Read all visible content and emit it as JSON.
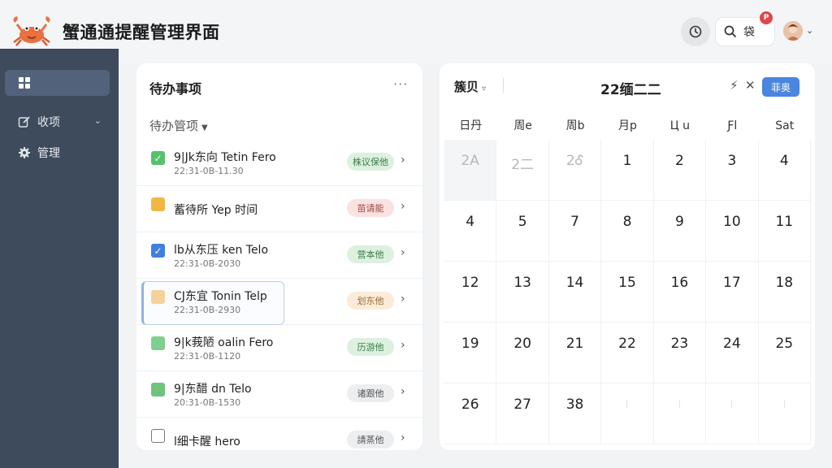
{
  "header": {
    "title": "蟹通通提醒管理界面",
    "search_label": "袋",
    "notif_badge": "P"
  },
  "sidebar": {
    "items": [
      {
        "label": "",
        "icon": "grid-icon"
      },
      {
        "label": "收项",
        "icon": "edit-icon"
      },
      {
        "label": "管理",
        "icon": "gear-icon"
      }
    ]
  },
  "todo": {
    "title": "待办事项",
    "more": "···",
    "filter": "待办管项",
    "items": [
      {
        "name": "9|Jk东向 Tetin Fero",
        "time": "22:31-0B-11.30",
        "tag": "株议保他",
        "check": "#56c26b",
        "tagBg": "#dcf1df",
        "tagColor": "#3d7b47",
        "mark": "✓"
      },
      {
        "name": "蓄待所 Yep 时间",
        "time": "",
        "tag": "苗请能",
        "check": "#f0b843",
        "tagBg": "#fbe1df",
        "tagColor": "#9c4a43",
        "mark": ""
      },
      {
        "name": "lb从东压 ken Telo",
        "time": "22:31-0B-2030",
        "tag": "营本他",
        "check": "#3f7fe0",
        "tagBg": "#dcf1df",
        "tagColor": "#3d7b47",
        "mark": "✓"
      },
      {
        "name": "CJ东宜 Tonin Telp",
        "time": "22:31-0B-2930",
        "tag": "划东他",
        "check": "#f5d29a",
        "tagBg": "#fbebd8",
        "tagColor": "#9a6c33",
        "mark": ""
      },
      {
        "name": "9|k莪陋 oalin Fero",
        "time": "22:31-0B-1120",
        "tag": "历游他",
        "check": "#7fcf8f",
        "tagBg": "#dcf1df",
        "tagColor": "#3d7b47",
        "mark": ""
      },
      {
        "name": "9|东醋 dn Telo",
        "time": "20:31-0B-1530",
        "tag": "诸跟他",
        "check": "#6ec37d",
        "tagBg": "#eceef0",
        "tagColor": "#555",
        "mark": ""
      },
      {
        "name": "l细卡醒 hero",
        "time": "",
        "tag": "請蒸他",
        "check": "#ffffff",
        "tagBg": "#eceef0",
        "tagColor": "#555",
        "mark": ""
      }
    ]
  },
  "calendar": {
    "view": "簇贝",
    "month": "22缅二二",
    "button": "菲奥",
    "weekdays": [
      "日丹",
      "周e",
      "周b",
      "月p",
      "Ц u",
      "Ƒl",
      "Sat"
    ],
    "days": [
      {
        "d": "2A",
        "muted": true
      },
      {
        "d": "2二",
        "muted": true
      },
      {
        "d": "2Ꮄ",
        "muted": true
      },
      {
        "d": "1"
      },
      {
        "d": "2"
      },
      {
        "d": "3"
      },
      {
        "d": "4"
      },
      {
        "d": "4"
      },
      {
        "d": "5"
      },
      {
        "d": "7"
      },
      {
        "d": "8"
      },
      {
        "d": "9"
      },
      {
        "d": "10"
      },
      {
        "d": "11"
      },
      {
        "d": "12"
      },
      {
        "d": "13"
      },
      {
        "d": "14"
      },
      {
        "d": "15"
      },
      {
        "d": "16"
      },
      {
        "d": "17"
      },
      {
        "d": "18"
      },
      {
        "d": "19"
      },
      {
        "d": "20"
      },
      {
        "d": "21"
      },
      {
        "d": "22"
      },
      {
        "d": "23"
      },
      {
        "d": "24"
      },
      {
        "d": "25"
      },
      {
        "d": "26"
      },
      {
        "d": "27"
      },
      {
        "d": "38"
      },
      {
        "d": "",
        "empty": true
      },
      {
        "d": "",
        "empty": true
      },
      {
        "d": "",
        "empty": true
      },
      {
        "d": "",
        "empty": true
      }
    ]
  }
}
